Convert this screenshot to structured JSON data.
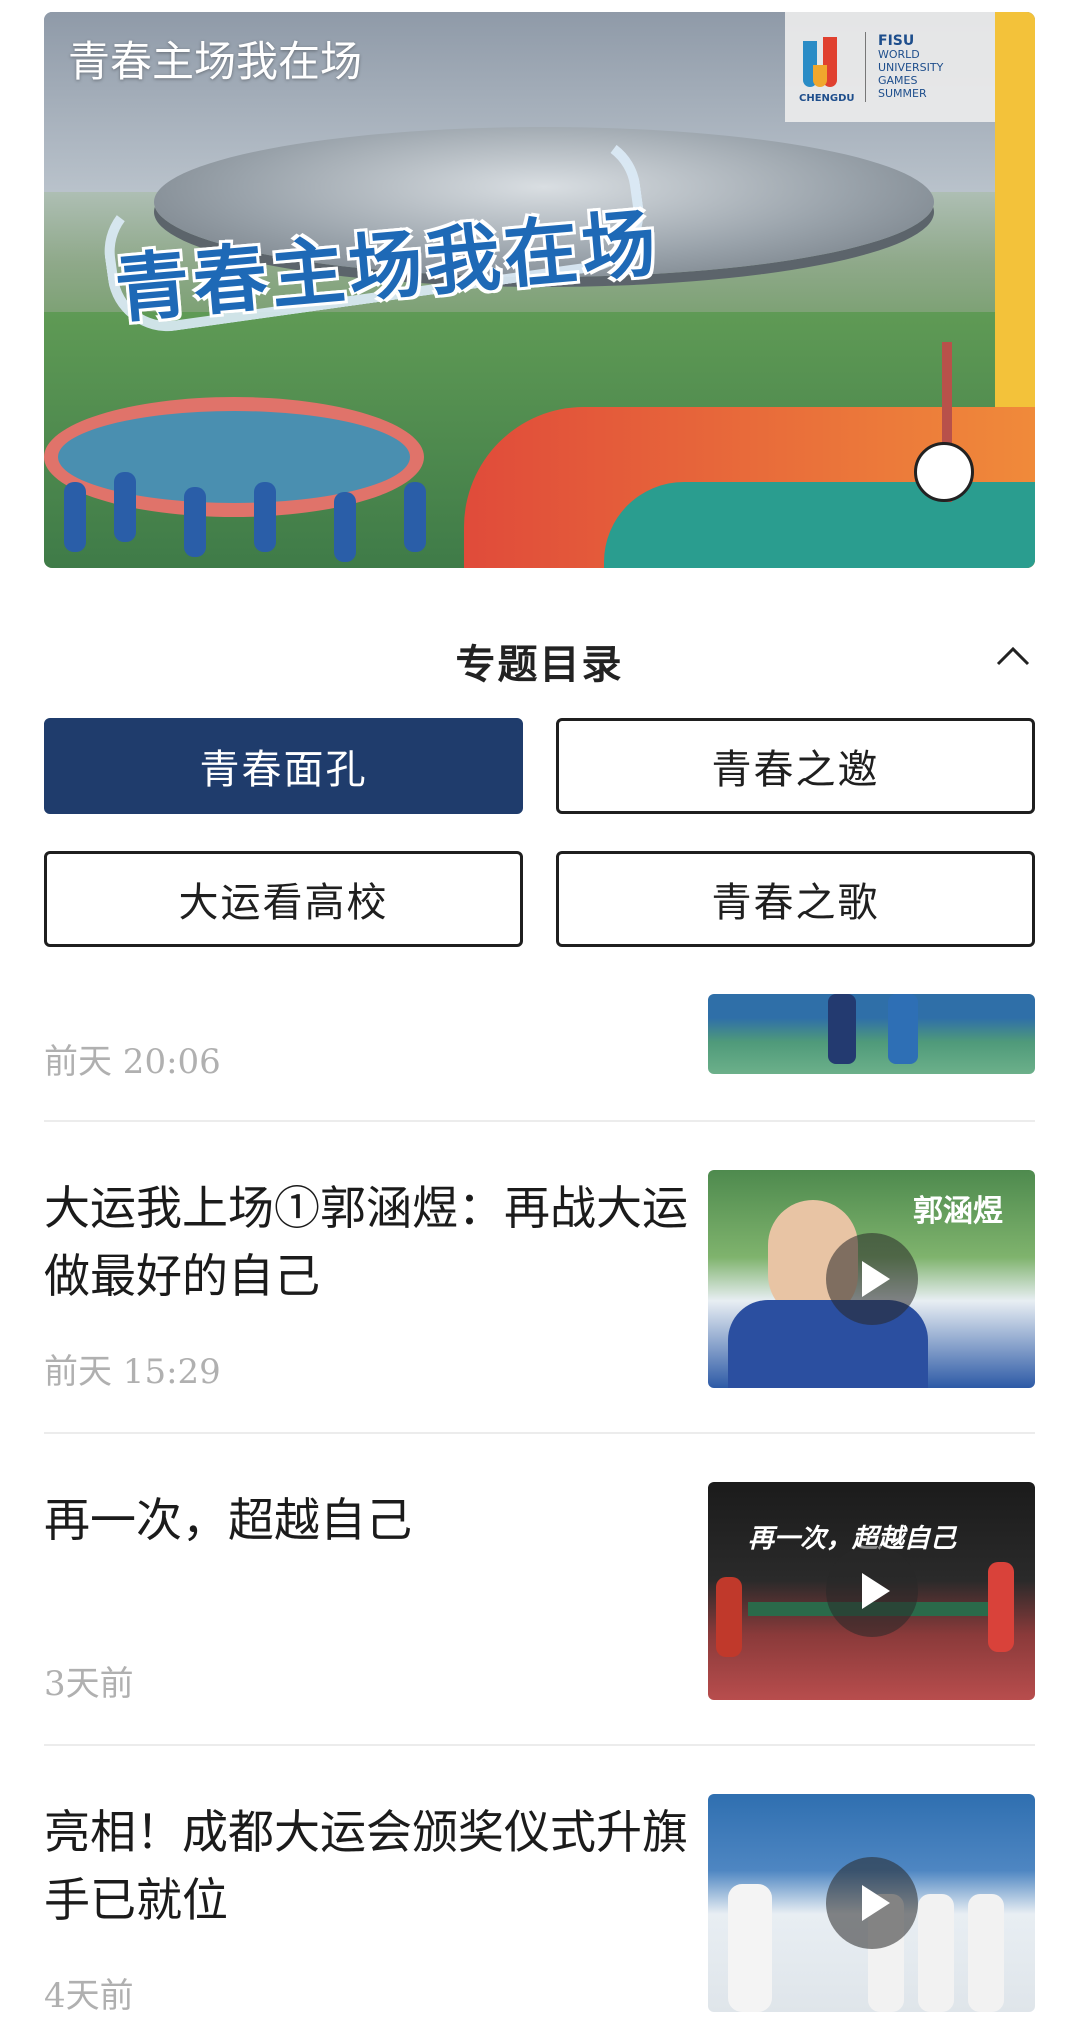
{
  "banner": {
    "corner_title": "青春主场我在场",
    "slogan": "青春主场我在场",
    "logo_city": "CHENGDU",
    "logo_lines": [
      "FISU",
      "WORLD",
      "UNIVERSITY",
      "GAMES",
      "SUMMER"
    ]
  },
  "section": {
    "title": "专题目录",
    "collapse_icon": "chevron-up-icon"
  },
  "topics": [
    {
      "label": "青春面孔",
      "active": true
    },
    {
      "label": "青春之邀",
      "active": false
    },
    {
      "label": "大运看高校",
      "active": false
    },
    {
      "label": "青春之歌",
      "active": false
    }
  ],
  "articles": [
    {
      "title": "",
      "time": "前天 20:06"
    },
    {
      "title": "大运我上场①郭涵煜：再战大运 做最好的自己",
      "time": "前天 15:29",
      "thumb_caption": "郭涵煜"
    },
    {
      "title": "再一次，超越自己",
      "time": "3天前",
      "thumb_caption": "再一次，超越自己"
    },
    {
      "title": "亮相！成都大运会颁奖仪式升旗手已就位",
      "time": "4天前"
    }
  ],
  "colors": {
    "active_button": "#1f3c6c",
    "time_text": "#b0b0b0"
  }
}
